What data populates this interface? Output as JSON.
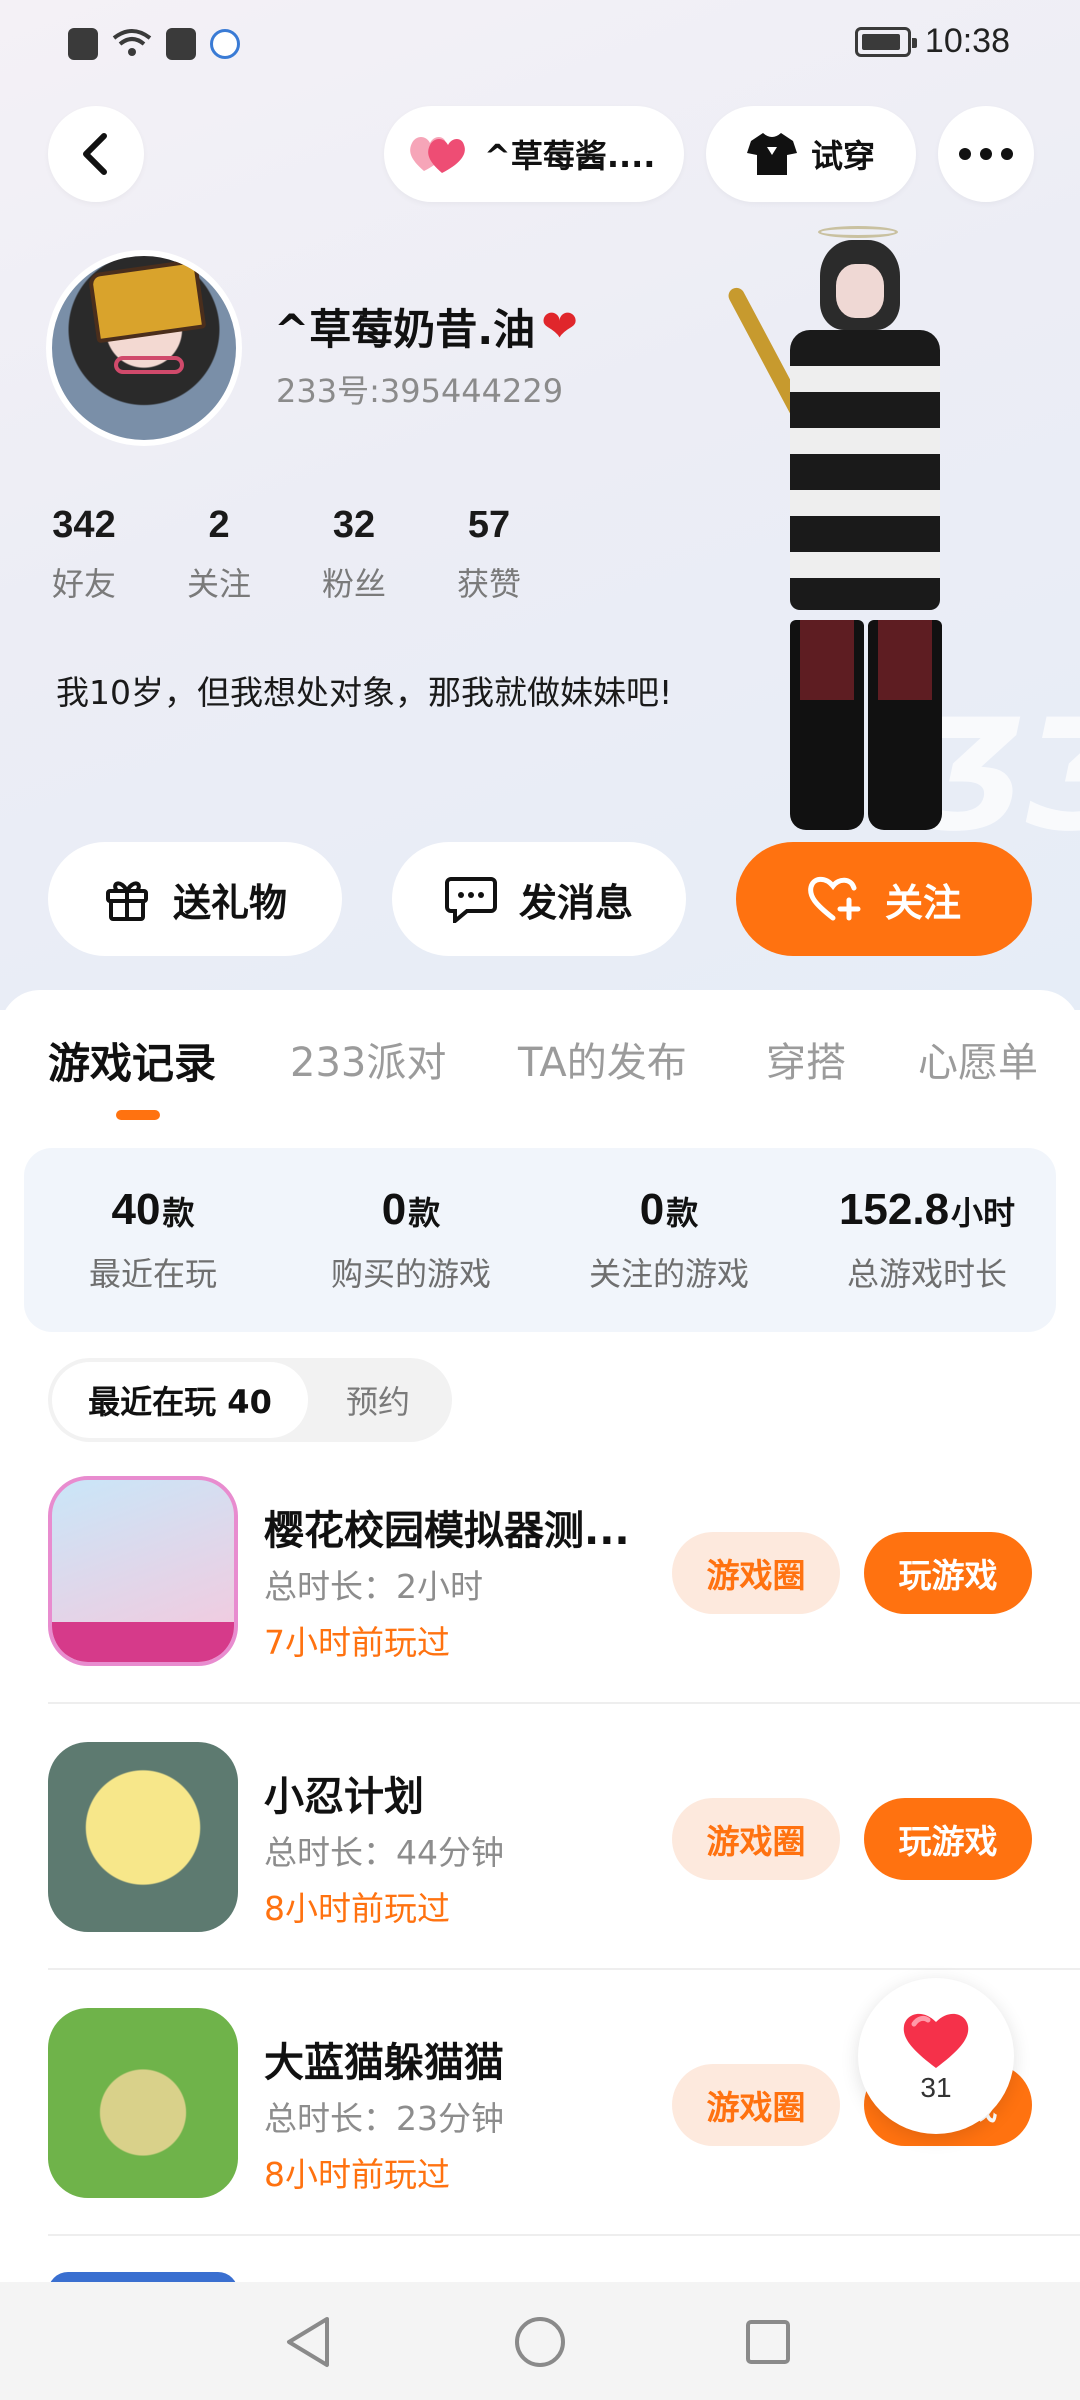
{
  "status_bar": {
    "time": "10:38"
  },
  "header": {
    "friend_name": "^草莓酱....",
    "try_on_label": "试穿"
  },
  "profile": {
    "nickname": "^草莓奶昔.油",
    "nickname_emoji": "❤",
    "user_id": "233号:395444229",
    "stats": [
      {
        "value": "342",
        "label": "好友"
      },
      {
        "value": "2",
        "label": "关注"
      },
      {
        "value": "32",
        "label": "粉丝"
      },
      {
        "value": "57",
        "label": "获赞"
      }
    ],
    "bio": "我10岁，但我想处对象，那我就做妹妹吧!"
  },
  "actions": {
    "gift_label": "送礼物",
    "message_label": "发消息",
    "follow_label": "关注"
  },
  "tabs": [
    {
      "label": "游戏记录",
      "active": true
    },
    {
      "label": "233派对"
    },
    {
      "label": "TA的发布"
    },
    {
      "label": "穿搭"
    },
    {
      "label": "心愿单"
    }
  ],
  "summary": [
    {
      "value": "40",
      "unit": "款",
      "label": "最近在玩"
    },
    {
      "value": "0",
      "unit": "款",
      "label": "购买的游戏"
    },
    {
      "value": "0",
      "unit": "款",
      "label": "关注的游戏"
    },
    {
      "value": "152.8",
      "unit": "小时",
      "label": "总游戏时长"
    }
  ],
  "segments": [
    {
      "label": "最近在玩 40",
      "active": true
    },
    {
      "label": "预约"
    }
  ],
  "games": [
    {
      "title": "樱花校园模拟器测...",
      "duration": "总时长：2小时",
      "last_played": "7小时前玩过",
      "circle_label": "游戏圈",
      "play_label": "玩游戏"
    },
    {
      "title": "小忍计划",
      "duration": "总时长：44分钟",
      "last_played": "8小时前玩过",
      "circle_label": "游戏圈",
      "play_label": "玩游戏"
    },
    {
      "title": "大蓝猫躲猫猫",
      "duration": "总时长：23分钟",
      "last_played": "8小时前玩过",
      "circle_label": "游戏圈",
      "play_label": "玩游戏"
    }
  ],
  "floating_like": {
    "count": "31"
  },
  "colors": {
    "accent": "#ff7210",
    "accent_soft": "#fde9dd",
    "heart": "#e0262b"
  }
}
